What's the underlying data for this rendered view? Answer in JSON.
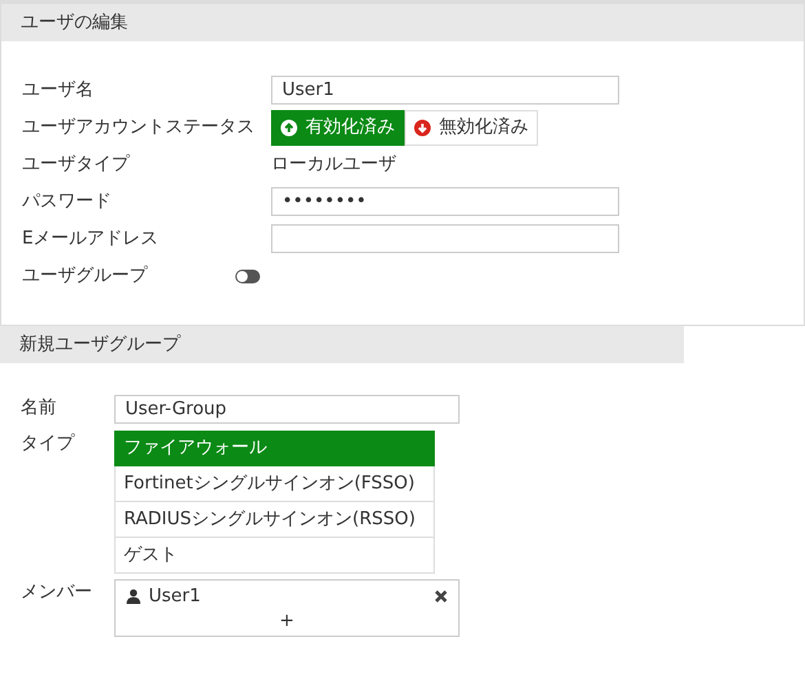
{
  "edit_user": {
    "title": "ユーザの編集",
    "fields": [
      {
        "kind": "input",
        "label": "ユーザ名",
        "value": "User1"
      },
      {
        "kind": "status",
        "label": "ユーザアカウントステータス",
        "options": [
          {
            "label": "有効化済み",
            "selected": true
          },
          {
            "label": "無効化済み",
            "selected": false
          }
        ]
      },
      {
        "kind": "text",
        "label": "ユーザタイプ",
        "value": "ローカルユーザ"
      },
      {
        "kind": "input",
        "label": "パスワード",
        "value": "••••••••"
      },
      {
        "kind": "input",
        "label": "Eメールアドレス"
      },
      {
        "kind": "toggle",
        "label": "ユーザグループ",
        "on": false
      }
    ]
  },
  "new_group": {
    "title": "新規ユーザグループ",
    "name": {
      "label": "名前",
      "value": "User-Group"
    },
    "type": {
      "label": "タイプ",
      "options": [
        {
          "label": "ファイアウォール",
          "selected": true
        },
        {
          "label": "Fortinetシングルサインオン(FSSO)",
          "selected": false
        },
        {
          "label": "RADIUSシングルサインオン(RSSO)",
          "selected": false
        },
        {
          "label": "ゲスト",
          "selected": false
        }
      ]
    },
    "members": {
      "label": "メンバー",
      "items": [
        "User1"
      ],
      "add": "+"
    }
  }
}
